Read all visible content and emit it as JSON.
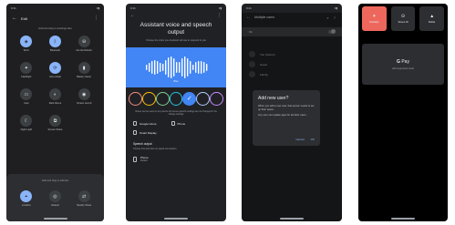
{
  "phone1": {
    "time": "9:41",
    "title": "Edit",
    "hint_top": "Hold and drag to rearrange tiles",
    "tiles": [
      {
        "label": "Wi-Fi",
        "icon": "wifi-icon",
        "glyph": "◈",
        "on": true
      },
      {
        "label": "Bluetooth",
        "icon": "bluetooth-icon",
        "glyph": "ᛒ",
        "on": true
      },
      {
        "label": "Do Not Disturb",
        "icon": "dnd-icon",
        "glyph": "⊖",
        "on": false
      },
      {
        "label": "Flashlight",
        "icon": "flashlight-icon",
        "glyph": "✦",
        "on": false
      },
      {
        "label": "Auto-rotate",
        "icon": "rotate-icon",
        "glyph": "⟳",
        "on": true
      },
      {
        "label": "Battery Saver",
        "icon": "battery-icon",
        "glyph": "▮",
        "on": false
      },
      {
        "label": "Cast",
        "icon": "cast-icon",
        "glyph": "▭",
        "on": false
      },
      {
        "label": "Dark theme",
        "icon": "dark-theme-icon",
        "glyph": "◐",
        "on": false
      },
      {
        "label": "Screen record",
        "icon": "screen-record-icon",
        "glyph": "◉",
        "on": false
      },
      {
        "label": "Night Light",
        "icon": "night-light-icon",
        "glyph": "☾",
        "on": false
      },
      {
        "label": "Screen Share",
        "icon": "screen-share-icon",
        "glyph": "⧉",
        "on": false
      }
    ],
    "hint_tray": "Hold and drag to add tiles",
    "tray_tiles": [
      {
        "label": "Location",
        "icon": "location-icon",
        "glyph": "⌖",
        "on": true
      },
      {
        "label": "Hotspot",
        "icon": "hotspot-icon",
        "glyph": "◎",
        "on": false
      },
      {
        "label": "Nearby Share",
        "icon": "nearby-share-icon",
        "glyph": "⇄",
        "on": false
      }
    ]
  },
  "phone2": {
    "time": "9:41",
    "heading": "Assistant voice and speech output",
    "subtitle": "Choose the voice you Assistant will use to respond to you",
    "voice_name": "Blue",
    "colors": [
      "#f28b82",
      "#fbbc04",
      "#81c995",
      "#24c1e0",
      "#4285f4",
      "#aecbfa",
      "#c58af9"
    ],
    "selected_color_index": 4,
    "note": "Voices can be used on any device but device-specific settings are not changed in the change settings",
    "devices": [
      "Google Home",
      "Phone"
    ],
    "device3": "Smart Display",
    "speech_heading": "Speech output",
    "speech_sub": "Choose how and when to speak out answers",
    "phone_item_title": "Phone",
    "phone_item_sub": "Default"
  },
  "phone3": {
    "time": "9:41",
    "title": "Multiple users",
    "on_label": "On",
    "users": [
      "You (Owner)",
      "Guest",
      "Family"
    ],
    "dialog": {
      "title": "Add new user?",
      "body1": "When you add a new user, that person needs to set up their space.",
      "body2": "Any user can update apps for all other users.",
      "cancel": "Cancel",
      "ok": "OK"
    }
  },
  "phone4": {
    "tiles": [
      {
        "label": "Flashlight",
        "icon": "flashlight-icon",
        "glyph": "✦",
        "active": true
      },
      {
        "label": "Screen off",
        "icon": "screen-off-icon",
        "glyph": "⊙",
        "active": false
      },
      {
        "label": "Mobile",
        "icon": "mobile-data-icon",
        "glyph": "▲",
        "active": false
      }
    ],
    "pay_brand": "G",
    "pay_label": "Pay",
    "pay_sub": "Add supported cards"
  }
}
